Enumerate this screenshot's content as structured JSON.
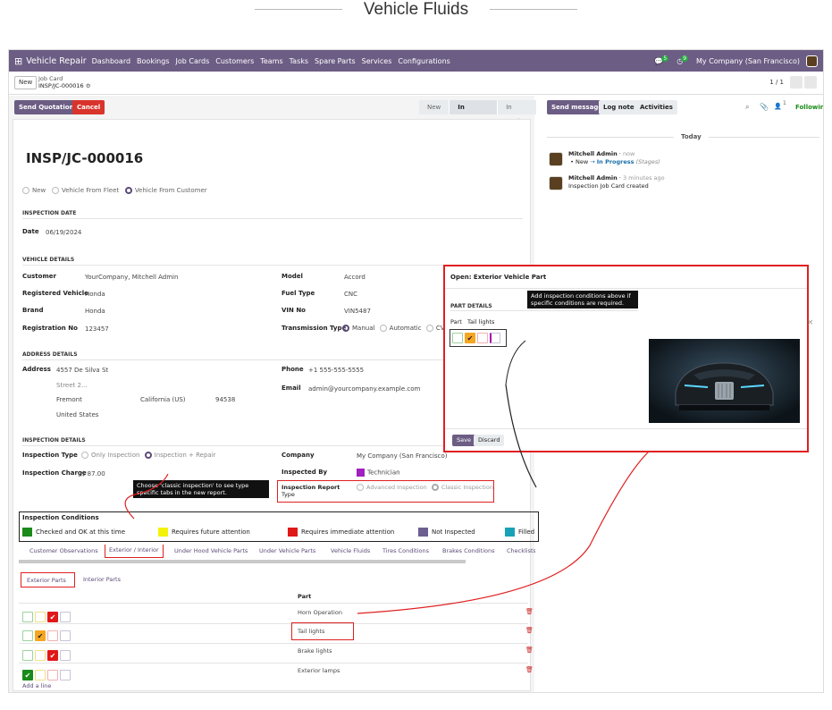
{
  "page_title": "Vehicle Fluids",
  "topbar": {
    "app": "Vehicle Repair",
    "menu": [
      "Dashboard",
      "Bookings",
      "Job Cards",
      "Customers",
      "Teams",
      "Tasks",
      "Spare Parts",
      "Services",
      "Configurations"
    ],
    "company": "My Company (San Francisco)",
    "msg_badge": "5",
    "act_badge": "9"
  },
  "breadcrumb": {
    "new": "New",
    "parent": "Job Card",
    "current": "INSP/JC-000016",
    "pager": "1 / 1"
  },
  "actions": {
    "send_quotation": "Send Quotation",
    "cancel": "Cancel"
  },
  "stages": [
    "New",
    "In Progress",
    "In Review"
  ],
  "record": {
    "name": "INSP/JC-000016",
    "source_options": [
      "New",
      "Vehicle From Fleet",
      "Vehicle From Customer"
    ]
  },
  "inspection_date": {
    "section": "INSPECTION DATE",
    "label": "Date",
    "value": "06/19/2024"
  },
  "vehicle": {
    "section": "VEHICLE DETAILS",
    "customer_l": "Customer",
    "customer": "YourCompany, Mitchell Admin",
    "reg_vehicle_l": "Registered Vehicle",
    "reg_vehicle": "Honda",
    "brand_l": "Brand",
    "brand": "Honda",
    "regno_l": "Registration No",
    "regno": "123457",
    "model_l": "Model",
    "model": "Accord",
    "fuel_l": "Fuel Type",
    "fuel": "CNC",
    "vin_l": "VIN No",
    "vin": "VIN5487",
    "trans_l": "Transmission Type",
    "trans": [
      "Manual",
      "Automatic",
      "CVT"
    ]
  },
  "address": {
    "section": "ADDRESS DETAILS",
    "label": "Address",
    "street": "4557 De Silva St",
    "street2": "Street 2...",
    "city": "Fremont",
    "state": "California (US)",
    "zip": "94538",
    "country": "United States",
    "phone_l": "Phone",
    "phone": "+1 555-555-5555",
    "email_l": "Email",
    "email": "admin@yourcompany.example.com"
  },
  "inspection": {
    "section": "INSPECTION DETAILS",
    "type_l": "Inspection Type",
    "types": [
      "Only Inspection",
      "Inspection + Repair"
    ],
    "charge_l": "Inspection Charge",
    "charge": "$ 87.00",
    "company_l": "Company",
    "company": "My Company (San Francisco)",
    "by_l": "Inspected By",
    "by": "Technician",
    "report_l": "Inspection Report",
    "report_l2": "Type",
    "report_opts": [
      "Advanced Inspection",
      "Classic Inspection"
    ]
  },
  "tip_classic": "Choose 'classic inspection' to see type specific tabs in the new report.",
  "conditions": {
    "title": "Inspection Conditions",
    "items": [
      {
        "label": "Checked and OK at this time",
        "color": "#1a8a1a"
      },
      {
        "label": "Requires future attention",
        "color": "#f5f20a"
      },
      {
        "label": "Requires immediate attention",
        "color": "#e01818"
      },
      {
        "label": "Not Inspected",
        "color": "#6d5f8f"
      },
      {
        "label": "Filled",
        "color": "#17a2b8"
      }
    ]
  },
  "tabs": [
    "Customer Observations",
    "Exterior / Interior",
    "Under Hood Vehicle Parts",
    "Under Vehicle Parts",
    "Vehicle Fluids",
    "Tires Conditions",
    "Brakes Conditions",
    "Checklists"
  ],
  "subtabs": [
    "Exterior Parts",
    "Interior Parts"
  ],
  "parts": {
    "header": "Part",
    "rows": [
      {
        "name": "Horn Operation",
        "checked": 2
      },
      {
        "name": "Tail lights",
        "checked": 1
      },
      {
        "name": "Brake lights",
        "checked": 2
      },
      {
        "name": "Exterior lamps",
        "checked": 0
      }
    ],
    "add": "Add a line"
  },
  "chatter": {
    "send": "Send message",
    "log": "Log note",
    "activities": "Activities",
    "follow": "Following",
    "followers": "1",
    "today": "Today",
    "m1_author": "Mitchell Admin",
    "m1_time": "now",
    "m1_from": "New",
    "m1_to": "In Progress",
    "m1_field": "(Stages)",
    "m2_author": "Mitchell Admin",
    "m2_time": "3 minutes ago",
    "m2_body": "Inspection Job Card created"
  },
  "dialog": {
    "title": "Open: Exterior Vehicle Part",
    "section": "PART DETAILS",
    "part_l": "Part",
    "part": "Tail lights",
    "tip": "Add inspection conditions above if specific conditions are required.",
    "save": "Save",
    "discard": "Discard"
  }
}
